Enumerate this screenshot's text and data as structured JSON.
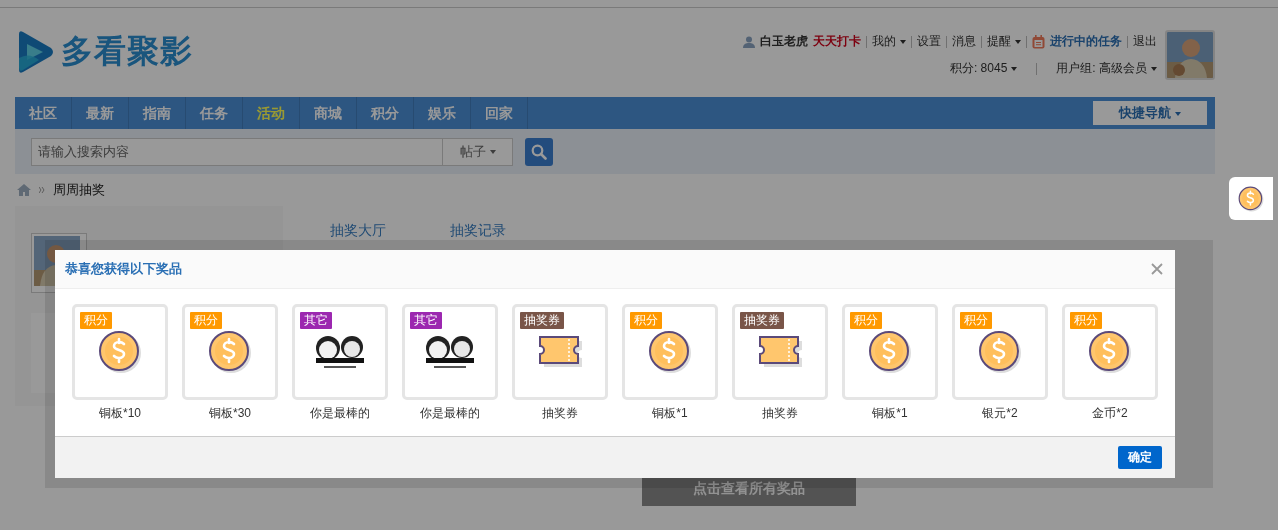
{
  "header": {
    "logo_text": "多看聚影",
    "user": {
      "name": "白玉老虎",
      "checkin": "天天打卡",
      "tasks": "进行中的任务",
      "logout": "退出",
      "points": "积分: 8045",
      "group": "用户组: 高级会员"
    },
    "links": [
      {
        "label": "我的",
        "dropdown": true
      },
      {
        "label": "设置",
        "dropdown": false
      },
      {
        "label": "消息",
        "dropdown": false
      },
      {
        "label": "提醒",
        "dropdown": true
      }
    ]
  },
  "nav": {
    "items": [
      {
        "label": "社区",
        "selected": false
      },
      {
        "label": "最新",
        "selected": false
      },
      {
        "label": "指南",
        "selected": false
      },
      {
        "label": "任务",
        "selected": false
      },
      {
        "label": "活动",
        "selected": true
      },
      {
        "label": "商城",
        "selected": false
      },
      {
        "label": "积分",
        "selected": false
      },
      {
        "label": "娱乐",
        "selected": false
      },
      {
        "label": "回家",
        "selected": false
      }
    ],
    "quick_nav": "快捷导航"
  },
  "search": {
    "placeholder": "请输入搜索内容",
    "type": "帖子"
  },
  "breadcrumb": [
    "周周抽奖"
  ],
  "lottery": {
    "tabs": [
      "抽奖大厅",
      "抽奖记录"
    ],
    "view_all": "点击查看所有奖品"
  },
  "modal": {
    "title": "恭喜您获得以下奖品",
    "confirm": "确定",
    "prizes": [
      {
        "tag": "积分",
        "color": "#ff9900",
        "kind": "coin",
        "name": "铜板*10"
      },
      {
        "tag": "积分",
        "color": "#ff9900",
        "kind": "coin",
        "name": "铜板*30"
      },
      {
        "tag": "其它",
        "color": "#9c27b0",
        "kind": "picture",
        "name": "你是最棒的"
      },
      {
        "tag": "其它",
        "color": "#9c27b0",
        "kind": "picture",
        "name": "你是最棒的"
      },
      {
        "tag": "抽奖券",
        "color": "#795548",
        "kind": "ticket",
        "name": "抽奖券"
      },
      {
        "tag": "积分",
        "color": "#ff9900",
        "kind": "coin",
        "name": "铜板*1"
      },
      {
        "tag": "抽奖券",
        "color": "#795548",
        "kind": "ticket",
        "name": "抽奖券"
      },
      {
        "tag": "积分",
        "color": "#ff9900",
        "kind": "coin",
        "name": "铜板*1"
      },
      {
        "tag": "积分",
        "color": "#ff9900",
        "kind": "coin",
        "name": "银元*2"
      },
      {
        "tag": "积分",
        "color": "#ff9900",
        "kind": "coin",
        "name": "金币*2"
      }
    ]
  }
}
